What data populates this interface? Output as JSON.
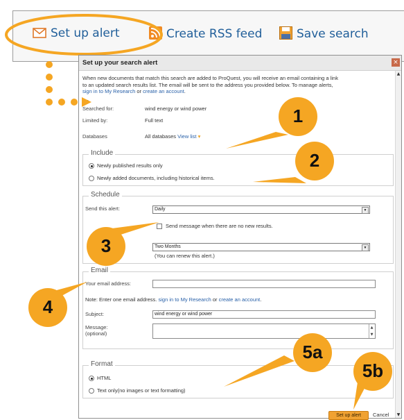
{
  "toolbar": {
    "set_up_alert": "Set up alert",
    "create_rss": "Create RSS feed",
    "save_search": "Save search"
  },
  "dialog": {
    "title": "Set up your search alert",
    "intro_1": "When new documents that match this search are added to ProQuest, you will receive an email containing a link",
    "intro_2": "to an updated search results list. The email will be sent to the address you provided below. To manage alerts,",
    "intro_link_1": "sign in to My Research",
    "intro_or": " or ",
    "intro_link_2": "create an account",
    "intro_end": ".",
    "clipped_text": "Se",
    "searched_for_label": "Searched for:",
    "searched_for_value": "wind energy or wind power",
    "limited_by_label": "Limited by:",
    "limited_by_value": "Full text",
    "databases_label": "Databases",
    "databases_value": "All databases",
    "view_list": "View list",
    "include": {
      "legend": "Include",
      "option_1": "Newly published results only",
      "option_2": "Newly added documents, including historical items.",
      "selected": 0
    },
    "schedule": {
      "legend": "Schedule",
      "send_label": "Send this alert:",
      "frequency": "Daily",
      "no_results_checkbox": "Send message when there are no new results.",
      "duration": "Two Months",
      "renew_note": "(You can renew this alert.)"
    },
    "email": {
      "legend": "Email",
      "address_label": "Your email address:",
      "address_value": "",
      "note_prefix": "Note: Enter one email address. ",
      "note_link_1": "sign in to My Research",
      "note_or": " or ",
      "note_link_2": "create an account",
      "note_end": ".",
      "subject_label": "Subject:",
      "subject_value": "wind energy or wind power",
      "message_label": "Message:",
      "message_optional": "(optional)",
      "message_value": ""
    },
    "format": {
      "legend": "Format",
      "option_1": "HTML",
      "option_2": "Text only(no images or text formatting)",
      "selected": 0
    },
    "submit_button": "Set up alert",
    "cancel_link": "Cancel"
  },
  "callouts": {
    "c1": "1",
    "c2": "2",
    "c3": "3",
    "c4": "4",
    "c5a": "5a",
    "c5b": "5b"
  },
  "colors": {
    "accent_orange": "#f5a623",
    "link_blue": "#215f9a",
    "button_orange": "#f0a232"
  }
}
